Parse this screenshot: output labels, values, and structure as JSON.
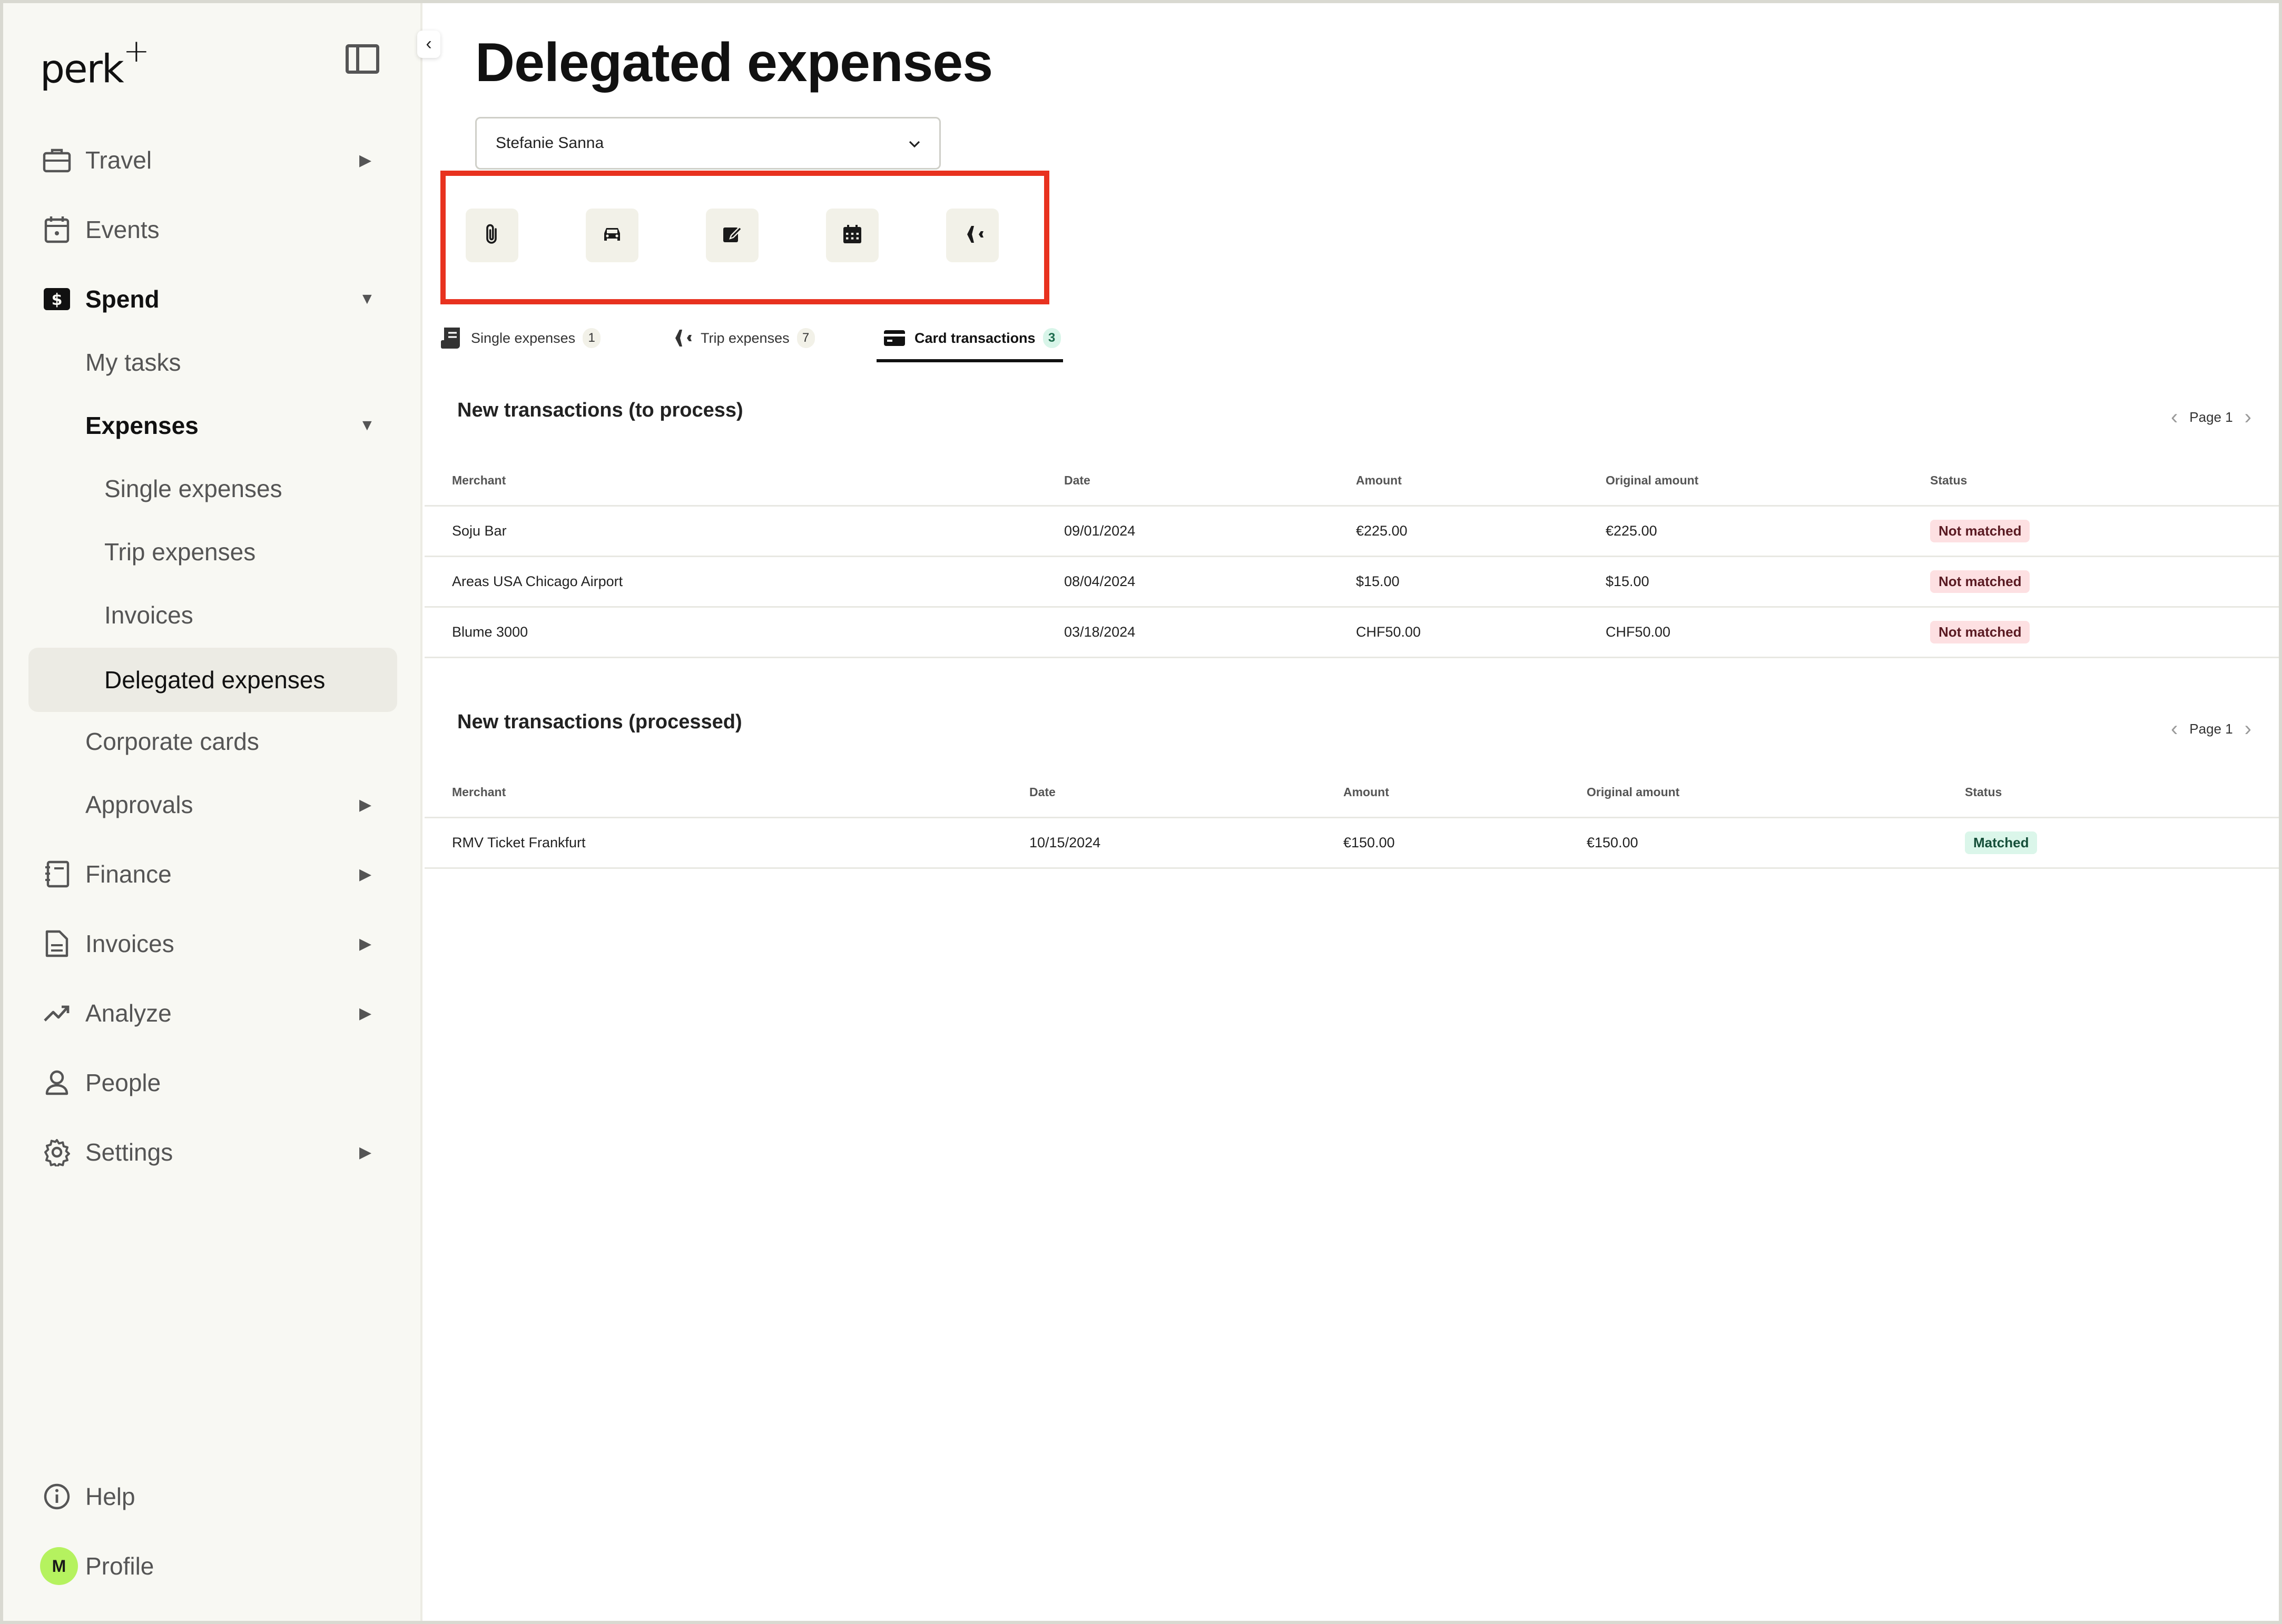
{
  "brand": {
    "logo": "perk",
    "logo_mark": "+"
  },
  "sidebar": {
    "items": [
      {
        "label": "Travel",
        "icon": "briefcase-icon",
        "expandable": true
      },
      {
        "label": "Events",
        "icon": "calendar-icon",
        "expandable": false
      },
      {
        "label": "Spend",
        "icon": "dollar-icon",
        "expandable": true,
        "expanded": true
      },
      {
        "label": "My tasks"
      },
      {
        "label": "Expenses",
        "expanded": true
      },
      {
        "label": "Single expenses"
      },
      {
        "label": "Trip expenses"
      },
      {
        "label": "Invoices"
      },
      {
        "label": "Delegated expenses",
        "active": true
      },
      {
        "label": "Corporate cards"
      },
      {
        "label": "Approvals",
        "expandable": true
      },
      {
        "label": "Finance",
        "icon": "ledger-icon",
        "expandable": true
      },
      {
        "label": "Invoices",
        "icon": "document-icon",
        "expandable": true
      },
      {
        "label": "Analyze",
        "icon": "trend-icon",
        "expandable": true
      },
      {
        "label": "People",
        "icon": "person-icon",
        "expandable": false
      },
      {
        "label": "Settings",
        "icon": "gear-icon",
        "expandable": true
      }
    ],
    "help_label": "Help",
    "profile_label": "Profile",
    "profile_initial": "M"
  },
  "main": {
    "title": "Delegated expenses",
    "user_select": {
      "value": "Stefanie Sanna"
    },
    "quick_actions": [
      "paperclip-icon",
      "car-icon",
      "edit-icon",
      "calendar-grid-icon",
      "airplane-icon"
    ],
    "tabs": [
      {
        "label": "Single expenses",
        "count": "1",
        "icon": "receipt-icon"
      },
      {
        "label": "Trip expenses",
        "count": "7",
        "icon": "airplane-icon"
      },
      {
        "label": "Card transactions",
        "count": "3",
        "icon": "card-icon",
        "active": true
      }
    ],
    "columns": {
      "merchant": "Merchant",
      "date": "Date",
      "amount": "Amount",
      "original_amount": "Original amount",
      "status": "Status"
    },
    "to_process": {
      "title": "New transactions (to process)",
      "page": "Page 1",
      "rows": [
        {
          "merchant": "Soju Bar",
          "date": "09/01/2024",
          "amount": "€225.00",
          "original_amount": "€225.00",
          "status": "Not matched"
        },
        {
          "merchant": "Areas USA Chicago Airport",
          "date": "08/04/2024",
          "amount": "$15.00",
          "original_amount": "$15.00",
          "status": "Not matched"
        },
        {
          "merchant": "Blume 3000",
          "date": "03/18/2024",
          "amount": "CHF50.00",
          "original_amount": "CHF50.00",
          "status": "Not matched"
        }
      ]
    },
    "processed": {
      "title": "New transactions (processed)",
      "page": "Page 1",
      "rows": [
        {
          "merchant": "RMV Ticket Frankfurt",
          "date": "10/15/2024",
          "amount": "€150.00",
          "original_amount": "€150.00",
          "status": "Matched"
        }
      ]
    }
  },
  "colors": {
    "sidebar_bg": "#f8f8f3",
    "highlight": "#e8321f",
    "not_matched_bg": "#fde0e2",
    "matched_bg": "#dbf6ea",
    "avatar_bg": "#b5f25f"
  }
}
